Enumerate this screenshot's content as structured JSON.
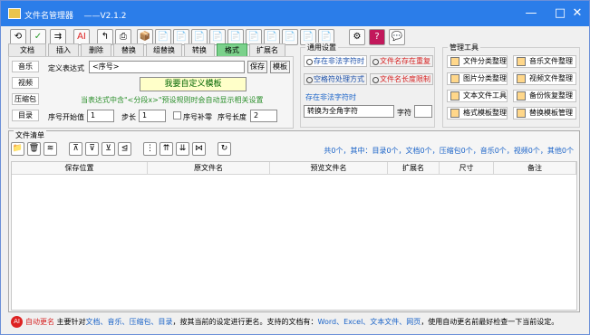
{
  "titlebar": {
    "title": "文件名管理器    ——V2.1.2",
    "min": "—",
    "max": "□",
    "close": "✕"
  },
  "toolbar": {
    "icons": [
      "⟲",
      "✓",
      "⇉",
      "AI",
      "↰",
      "⎙",
      "📦",
      "📄",
      "📄",
      "📄",
      "📄",
      "📄",
      "📄",
      "📄",
      "📄",
      "📄",
      "📄",
      "⚙",
      "?",
      "💬"
    ]
  },
  "tabs": [
    "文档",
    "插入",
    "删除",
    "替换",
    "组替换",
    "转换",
    "格式",
    "扩展名"
  ],
  "sidebar": [
    "音乐",
    "视频",
    "压缩包",
    "目录"
  ],
  "format": {
    "expr_label": "定义表达式",
    "expr_value": "<序号>",
    "save_button": "保存",
    "template_button": "模板",
    "big_button": "我要自定义模板",
    "hint": "当表达式中含\"<分段x>\"预设规则时会自动显示相关设置",
    "start_label": "序号开始值",
    "start_value": "1",
    "step_label": "步长",
    "step_value": "1",
    "pad_label": "序号补零",
    "len_label": "序号长度",
    "len_value": "2"
  },
  "general": {
    "title": "通用设置",
    "opt1": "存在非法字符时",
    "opt2": "文件名存在重复",
    "opt3": "空格符处理方式",
    "opt4": "文件名长度限制",
    "sub_title": "存在非法字符时",
    "select_value": "转换为全角字符",
    "char_label": "字符"
  },
  "tools": {
    "title": "管理工具",
    "items": [
      "文件分类整理",
      "音乐文件整理",
      "图片分类整理",
      "视频文件整理",
      "文本文件工具",
      "备份恢复整理",
      "格式模板整理",
      "替换模板管理"
    ]
  },
  "filelist": {
    "title": "文件清单",
    "stats": "共0个，其中：目录0个，文档0个，压缩包0个，音乐0个，视频0个，其他0个",
    "columns": [
      "保存位置",
      "原文件名",
      "预览文件名",
      "扩展名",
      "尺寸",
      "备注"
    ],
    "tool_icons": [
      "📁",
      "🗑",
      "≋",
      "⊼",
      "⊽",
      "⊻",
      "⊴",
      "⋮",
      "⇈",
      "⇊",
      "⋈",
      "↻"
    ]
  },
  "status": {
    "auto_label": "自动更名",
    "text1": "主要针对",
    "types": "文档、音乐、压缩包、目录",
    "text2": "，按其当前的设定进行更名。支持的文档有：",
    "formats": "Word、Excel、文本文件、网页",
    "text3": "，使用自动更名前最好检查一下当前设定。"
  },
  "colors": {
    "accent": "#2b7de9",
    "tab_active": "#7bd18b",
    "hint": "#2b8f2b",
    "stats": "#1a63c8"
  }
}
